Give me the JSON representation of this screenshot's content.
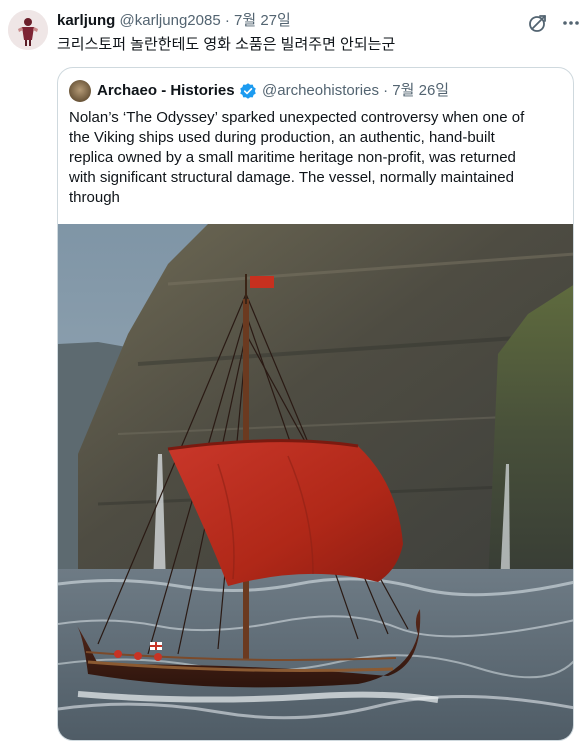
{
  "tweet": {
    "author_name": "karljung",
    "author_handle": "@karljung2085",
    "separator": "·",
    "date": "7월 27일",
    "text": "크리스토퍼 놀란한테도 영화 소품은 빌려주면 안되는군",
    "avatar_icon": "avatar-figure",
    "action_icons": [
      "grok-icon",
      "more-icon"
    ]
  },
  "quote": {
    "author_name": "Archaeo - Histories",
    "author_handle": "@archeohistories",
    "separator": "·",
    "date": "7월 26일",
    "verified_color": "#1d9bf0",
    "text_lines": [
      "Nolan’s ‘The Odyssey’ sparked unexpected controversy when one of",
      "the Viking ships used during production, an authentic, hand-built",
      "replica owned by a small maritime heritage non-profit, was returned",
      "with significant structural damage. The vessel, normally maintained",
      "through"
    ],
    "media": {
      "subject": "viking-longship-red-sail-photo",
      "sail_color": "#b92b1e"
    }
  }
}
